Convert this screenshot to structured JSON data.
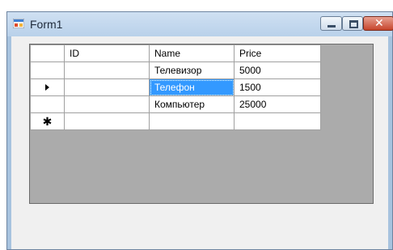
{
  "window": {
    "title": "Form1",
    "close_glyph": "✕"
  },
  "grid": {
    "columns": [
      "ID",
      "Name",
      "Price"
    ],
    "rows": [
      {
        "id": "",
        "name": "Телевизор",
        "price": "5000"
      },
      {
        "id": "",
        "name": "Телефон",
        "price": "1500"
      },
      {
        "id": "",
        "name": "Компьютер",
        "price": "25000"
      }
    ],
    "new_row_marker": "✱",
    "current_row_marker_icon": "row-pointer-icon",
    "selected_cell": {
      "row": 1,
      "column": "Name"
    },
    "selection_color": "#3399ff",
    "background_color": "#ababab"
  }
}
